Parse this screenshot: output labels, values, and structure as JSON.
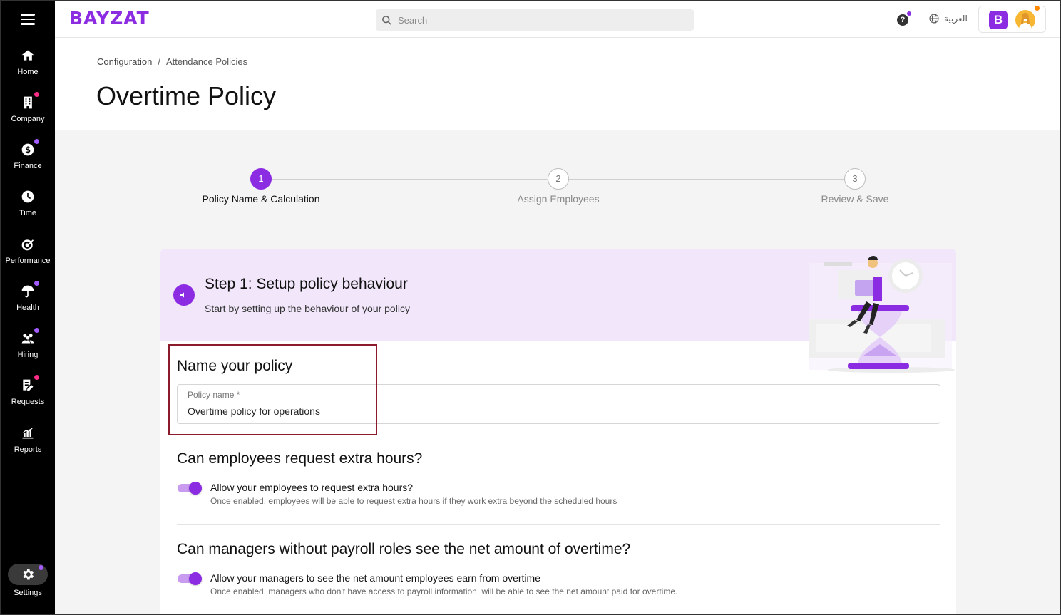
{
  "sidebar": {
    "items": [
      {
        "label": "Home"
      },
      {
        "label": "Company"
      },
      {
        "label": "Finance"
      },
      {
        "label": "Time"
      },
      {
        "label": "Performance"
      },
      {
        "label": "Health"
      },
      {
        "label": "Hiring"
      },
      {
        "label": "Requests"
      },
      {
        "label": "Reports"
      }
    ],
    "settings_label": "Settings",
    "dot_colors": {
      "pink": "#ff2d87",
      "purple": "#a45cff"
    }
  },
  "topbar": {
    "logo": "BAYZAT",
    "search_placeholder": "Search",
    "help_glyph": "?",
    "language": "العربية",
    "company_badge": "B"
  },
  "header": {
    "breadcrumb": {
      "link": "Configuration",
      "separator": "/",
      "current": "Attendance Policies"
    },
    "title": "Overtime Policy"
  },
  "stepper": {
    "steps": [
      {
        "number": "1",
        "label": "Policy Name & Calculation",
        "state": "active"
      },
      {
        "number": "2",
        "label": "Assign Employees",
        "state": "inactive"
      },
      {
        "number": "3",
        "label": "Review & Save",
        "state": "inactive"
      }
    ]
  },
  "card": {
    "heading": "Step 1: Setup policy behaviour",
    "subheading": "Start by setting up the behaviour of your policy",
    "name_section": {
      "title": "Name your policy",
      "field_label": "Policy name *",
      "field_value": "Overtime policy for operations"
    },
    "extra_hours": {
      "title": "Can employees request extra hours?",
      "option_label": "Allow your employees to request extra hours?",
      "option_help": "Once enabled, employees will be able to request extra hours if they work extra beyond the scheduled hours",
      "enabled": true
    },
    "net_amount": {
      "title": "Can managers without payroll roles see the net amount of overtime?",
      "option_label": "Allow your managers to see the net amount employees earn from overtime",
      "option_help": "Once enabled, managers who don't have access to payroll information, will be able to see the net amount paid for overtime.",
      "enabled": true
    }
  },
  "colors": {
    "brand": "#8b2be2",
    "highlight_box": "#8b1a2b",
    "header_band": "#f1e6fa"
  }
}
